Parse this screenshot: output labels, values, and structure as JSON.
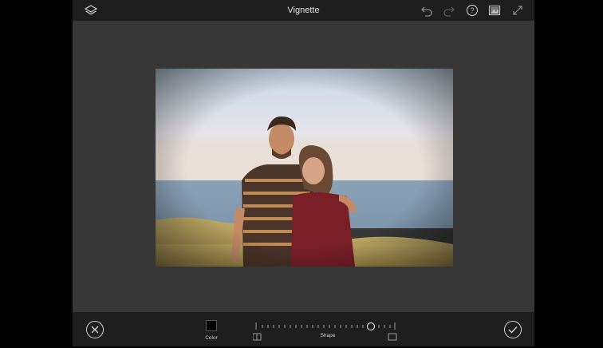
{
  "topbar": {
    "title": "Vignette",
    "left_icons": [
      "layers-icon"
    ],
    "right_icons": [
      "undo-icon",
      "redo-icon",
      "help-icon",
      "image-compare-icon",
      "fullscreen-icon"
    ]
  },
  "photo": {
    "description_icon": "photo-couple-on-hill"
  },
  "bottombar": {
    "cancel_icon": "close-circle-icon",
    "confirm_icon": "check-circle-icon",
    "color_label": "Color",
    "color_value": "#000000",
    "shape_label": "Shape",
    "shape_value": 0.84
  },
  "colors": {
    "app_background": "#373737",
    "bar_background": "#1e1e1e",
    "text": "#e0e0e0"
  }
}
